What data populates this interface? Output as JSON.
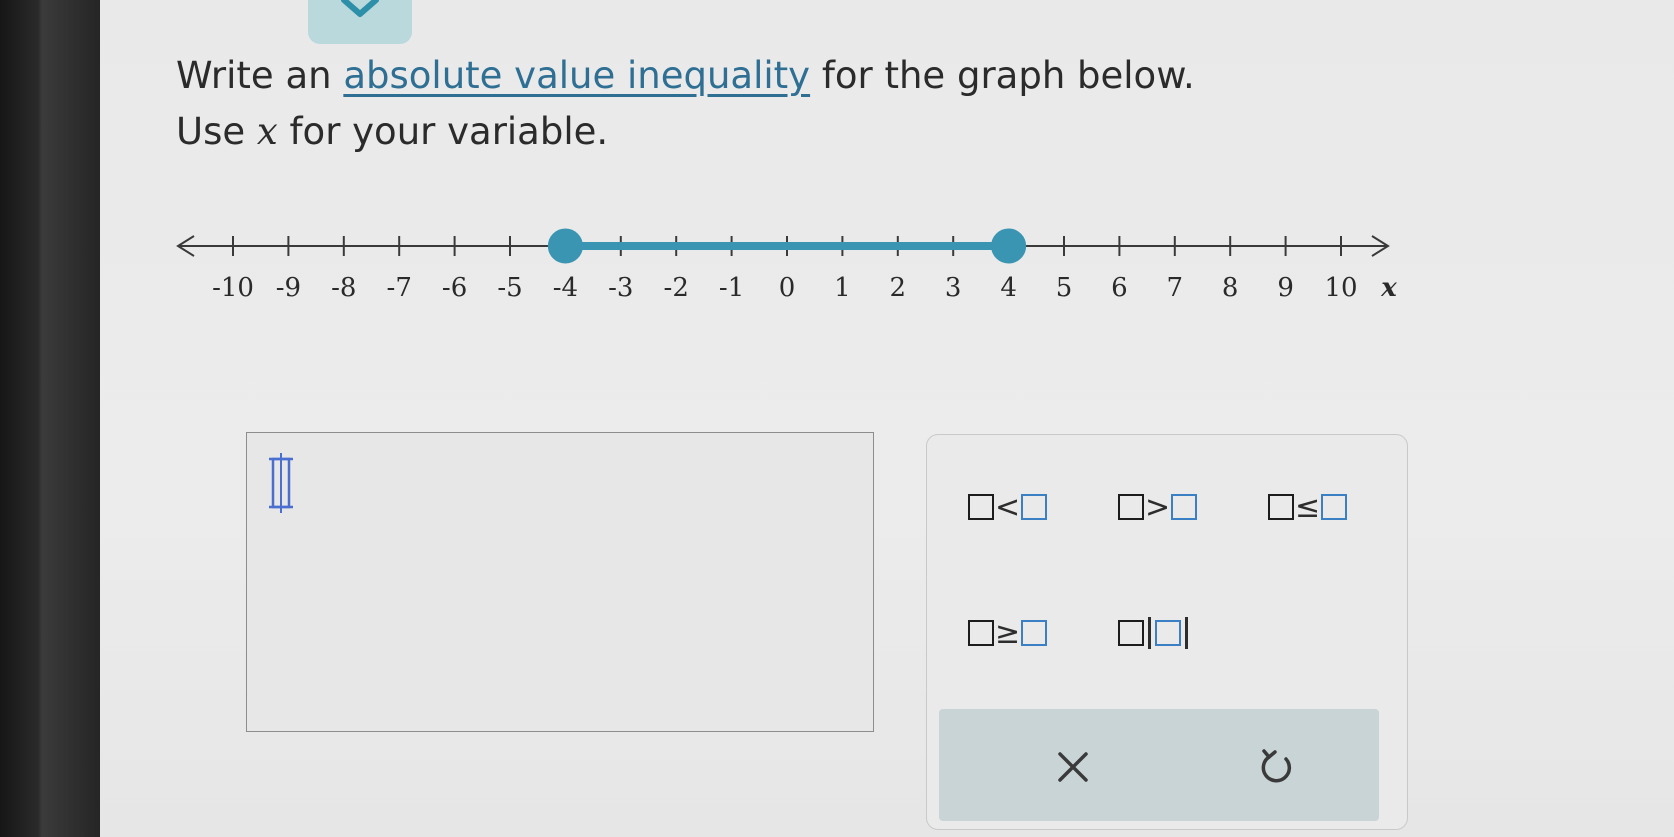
{
  "prompt": {
    "line1_prefix": "Write an ",
    "line1_link": "absolute value inequality",
    "line1_suffix": " for the graph below.",
    "line2_prefix": "Use ",
    "line2_var": "x",
    "line2_suffix": " for your variable."
  },
  "number_line": {
    "tick_labels": [
      "-10",
      "-9",
      "-8",
      "-7",
      "-6",
      "-5",
      "-4",
      "-3",
      "-2",
      "-1",
      "0",
      "1",
      "2",
      "3",
      "4",
      "5",
      "6",
      "7",
      "8",
      "9",
      "10"
    ],
    "variable": "x",
    "shaded_from": -4,
    "shaded_to": 4,
    "closed_endpoints": true,
    "accent_color": "#3a95b3"
  },
  "answer_input": {
    "value": ""
  },
  "keypad": {
    "less_than": "<",
    "greater_than": ">",
    "less_equal": "≤",
    "greater_equal": "≥",
    "clear_icon": "close-icon",
    "undo_icon": "undo-icon"
  }
}
